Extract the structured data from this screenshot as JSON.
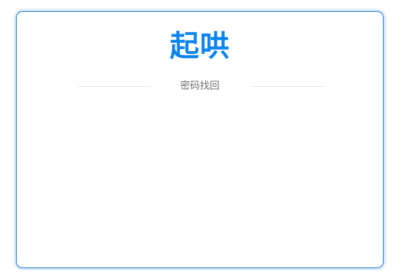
{
  "dialog": {
    "logo_text": "起哄",
    "subtitle": "密码找回"
  },
  "colors": {
    "accent": "#0a84f0",
    "border": "#2a7fd4",
    "divider": "#e3e3e3",
    "subtitle": "#6f6f6f"
  }
}
